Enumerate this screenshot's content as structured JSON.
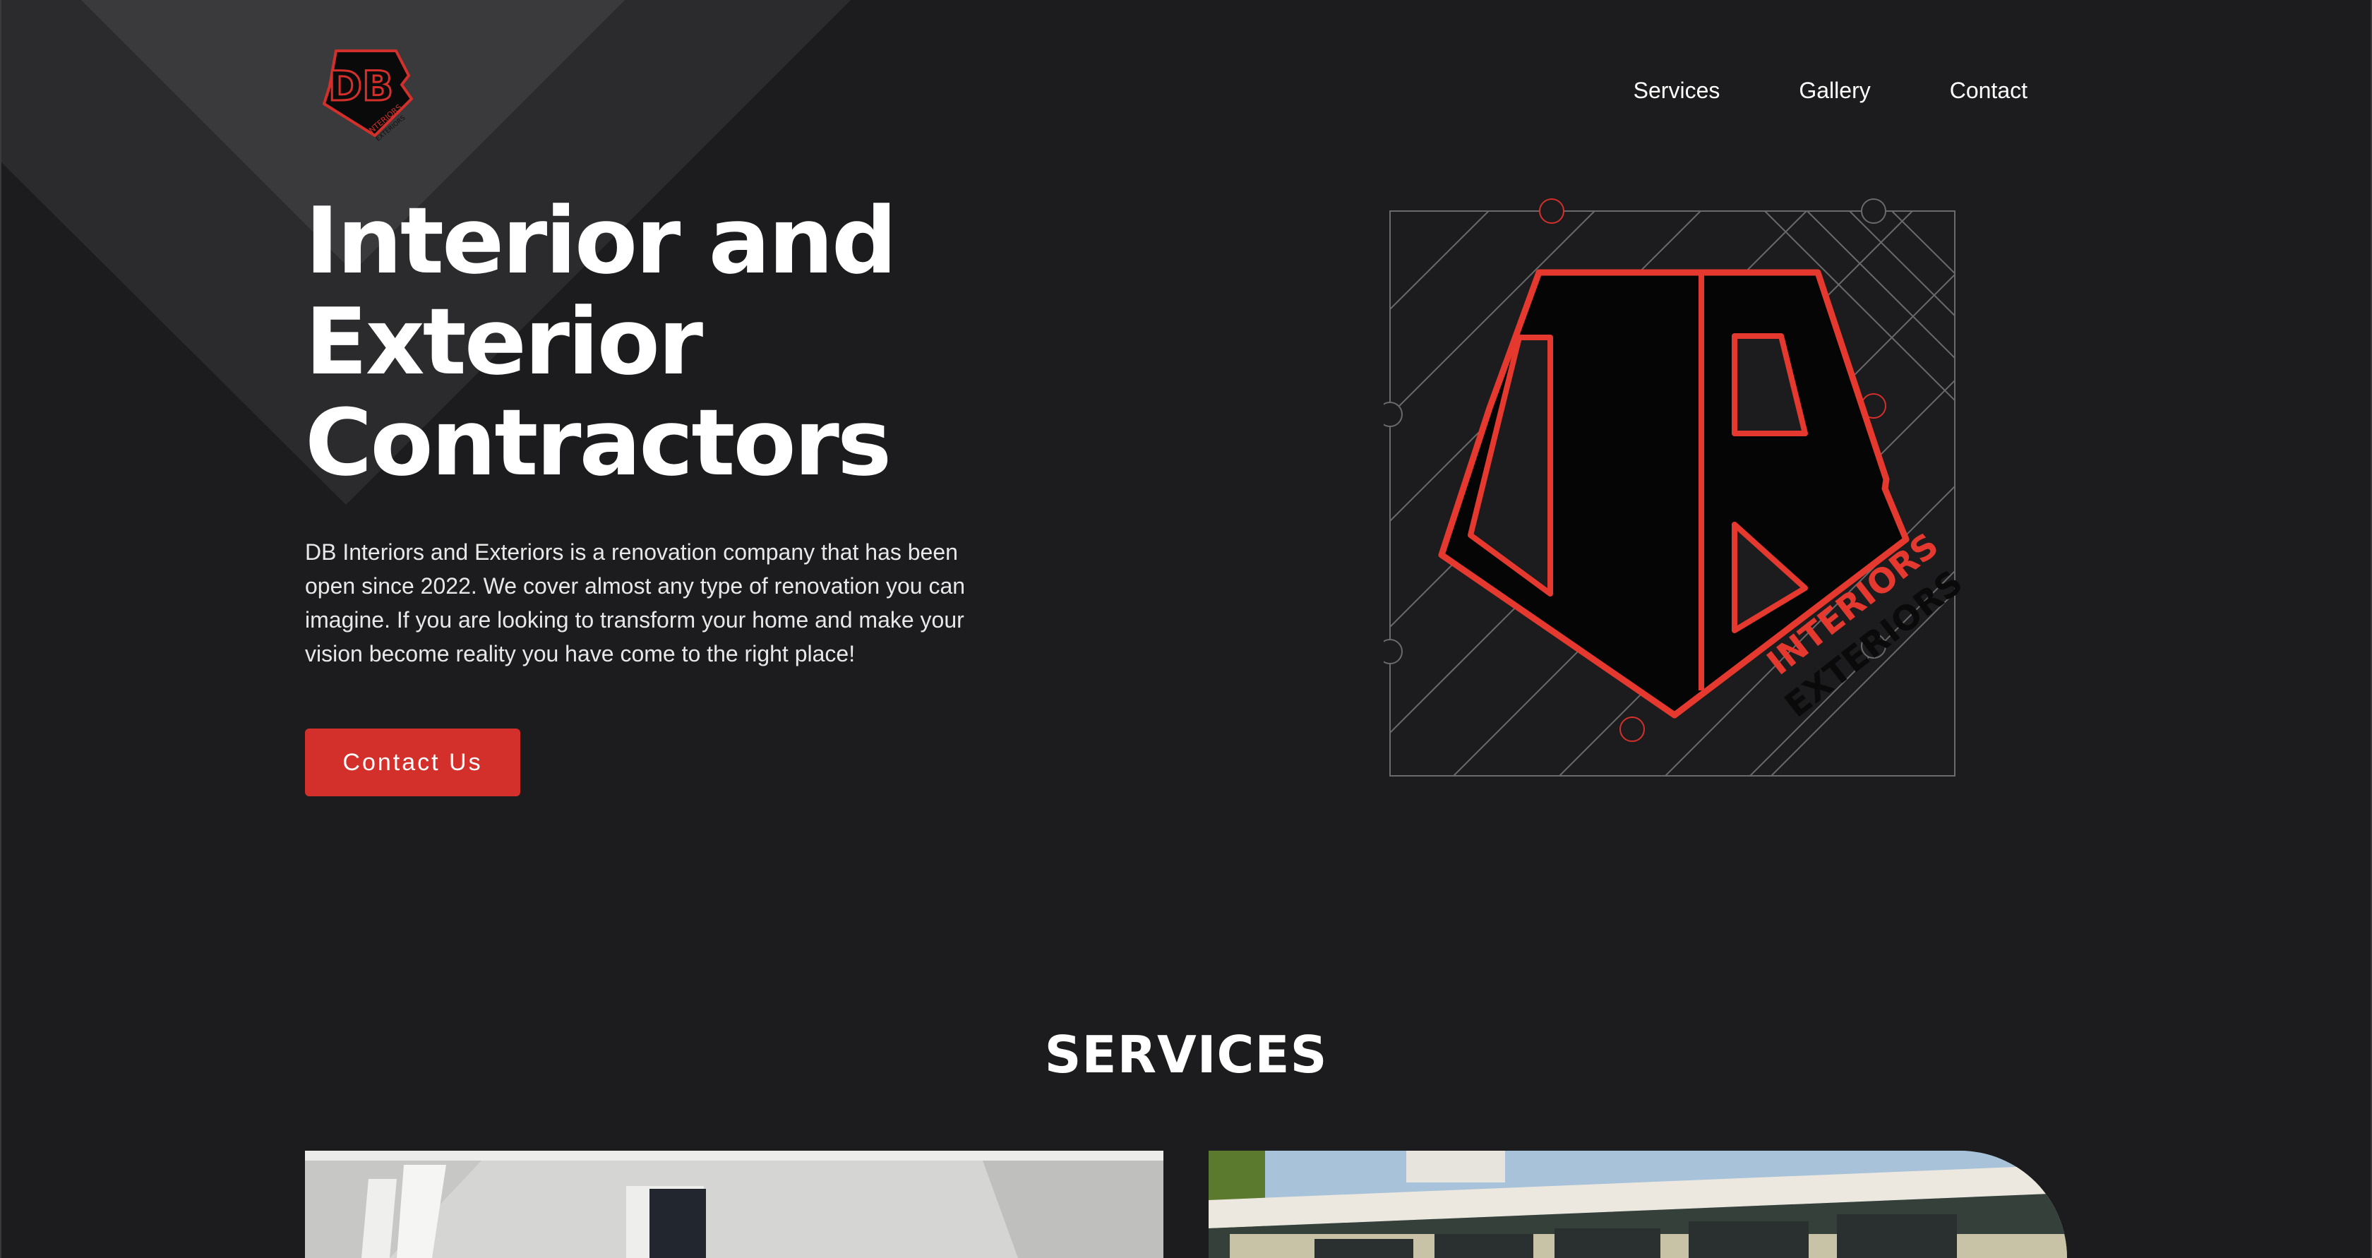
{
  "brand": {
    "logo_monogram": "DB",
    "logo_line1": "INTERIORS",
    "logo_line2": "EXTERIORS",
    "accent_color": "#d4302b",
    "background_color": "#1c1c1e"
  },
  "nav": {
    "items": [
      {
        "label": "Services"
      },
      {
        "label": "Gallery"
      },
      {
        "label": "Contact"
      }
    ]
  },
  "hero": {
    "title_line1": "Interior and",
    "title_line2": "Exterior",
    "title_line3": "Contractors",
    "description": "DB Interiors and Exteriors is a renovation company that has been open since 2022. We cover almost any type of renovation you can imagine. If you are looking to transform your home and make your vision become reality you have come to the right place!",
    "cta_label": "Contact Us"
  },
  "services": {
    "heading": "SERVICES",
    "cards": [
      {
        "image_icon": "interior-room-photo"
      },
      {
        "image_icon": "house-exterior-photo"
      }
    ]
  }
}
